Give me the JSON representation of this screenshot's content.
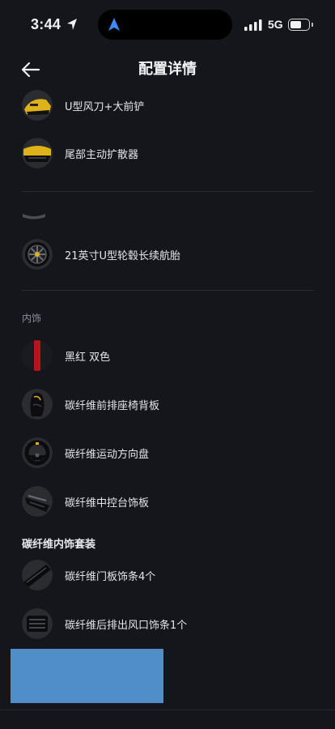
{
  "status_bar": {
    "time": "3:44",
    "network": "5G",
    "battery_level": 0.6
  },
  "header": {
    "title": "配置详情"
  },
  "exterior": {
    "items": [
      {
        "label": "U型风刀+大前铲",
        "icon": "front-spoiler-thumbnail"
      },
      {
        "label": "尾部主动扩散器",
        "icon": "rear-diffuser-thumbnail"
      },
      {
        "label": "21英寸U型轮毂长续航胎",
        "icon": "wheel-thumbnail"
      }
    ]
  },
  "interior": {
    "section_label": "内饰",
    "items": [
      {
        "label": "黑红 双色",
        "icon": "color-swatch-thumbnail"
      },
      {
        "label": "碳纤维前排座椅背板",
        "icon": "seat-back-thumbnail"
      },
      {
        "label": "碳纤维运动方向盘",
        "icon": "steering-wheel-thumbnail"
      },
      {
        "label": "碳纤维中控台饰板",
        "icon": "console-trim-thumbnail"
      }
    ],
    "group_title": "碳纤维内饰套装",
    "group_items": [
      {
        "label": "碳纤维门板饰条4个",
        "icon": "door-trim-thumbnail"
      },
      {
        "label": "碳纤维后排出风口饰条1个",
        "icon": "vent-trim-thumbnail"
      }
    ]
  },
  "colors": {
    "background": "#14161b",
    "accent_red": "#b8141b",
    "accent_yellow": "#e0b21a",
    "blue_block": "#4f8ec8"
  }
}
